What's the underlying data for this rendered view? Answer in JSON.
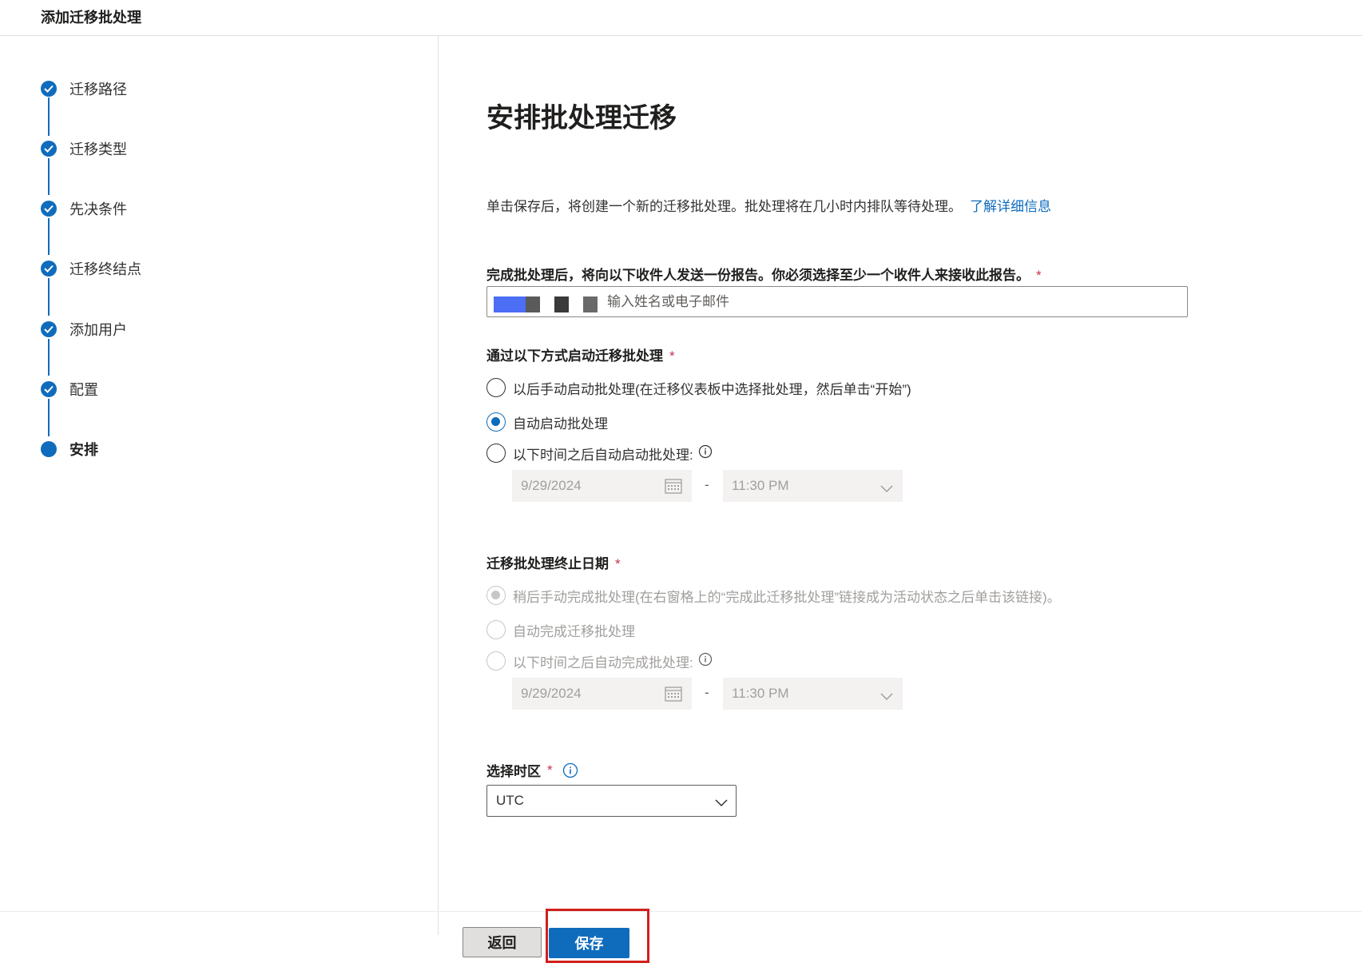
{
  "header": {
    "title": "添加迁移批处理"
  },
  "steps": [
    {
      "label": "迁移路径",
      "status": "completed"
    },
    {
      "label": "迁移类型",
      "status": "completed"
    },
    {
      "label": "先决条件",
      "status": "completed"
    },
    {
      "label": "迁移终结点",
      "status": "completed"
    },
    {
      "label": "添加用户",
      "status": "completed"
    },
    {
      "label": "配置",
      "status": "completed"
    },
    {
      "label": "安排",
      "status": "current"
    }
  ],
  "main": {
    "title": "安排批处理迁移",
    "description": "单击保存后，将创建一个新的迁移批处理。批处理将在几小时内排队等待处理。",
    "learn_more": "了解详细信息",
    "recipients": {
      "label": "完成批处理后，将向以下收件人发送一份报告。你必须选择至少一个收件人来接收此报告。",
      "required_mark": "*",
      "placeholder": "输入姓名或电子邮件"
    },
    "start": {
      "label": "通过以下方式启动迁移批处理",
      "required_mark": "*",
      "options": [
        {
          "label": "以后手动启动批处理(在迁移仪表板中选择批处理，然后单击“开始”)",
          "checked": false
        },
        {
          "label": "自动启动批处理",
          "checked": true
        },
        {
          "label": "以下时间之后自动启动批处理:",
          "checked": false
        }
      ],
      "date": "9/29/2024",
      "separator": "-",
      "time": "11:30 PM"
    },
    "end": {
      "label": "迁移批处理终止日期",
      "required_mark": "*",
      "options": [
        {
          "label": "稍后手动完成批处理(在右窗格上的“完成此迁移批处理”链接成为活动状态之后单击该链接)。",
          "checked": true,
          "disabled": true
        },
        {
          "label": "自动完成迁移批处理",
          "checked": false,
          "disabled": true
        },
        {
          "label": "以下时间之后自动完成批处理:",
          "checked": false,
          "disabled": true
        }
      ],
      "date": "9/29/2024",
      "separator": "-",
      "time": "11:30 PM"
    },
    "timezone": {
      "label": "选择时区",
      "required_mark": "*",
      "value": "UTC"
    }
  },
  "footer": {
    "back_label": "返回",
    "save_label": "保存"
  },
  "colors": {
    "accent": "#0f6cbd",
    "required": "#c4314b",
    "highlight": "#d0201c"
  },
  "icons": [
    "checkmark-icon",
    "info-icon",
    "calendar-icon",
    "chevron-down-icon"
  ]
}
